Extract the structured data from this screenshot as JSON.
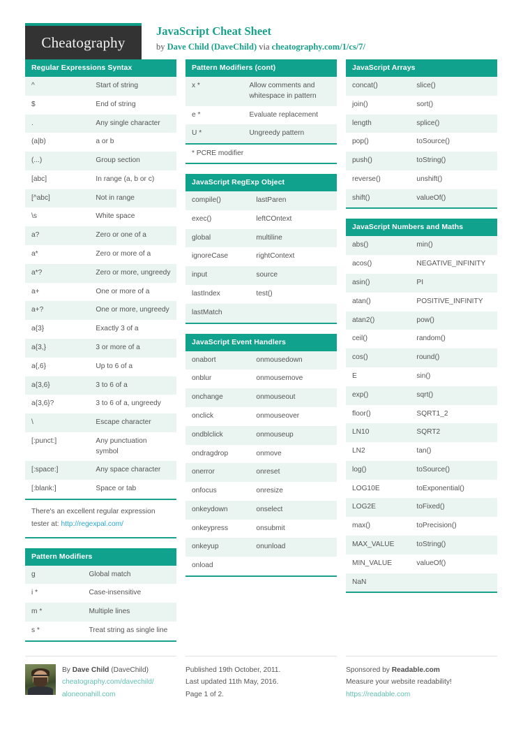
{
  "header": {
    "logo": "Cheatography",
    "title": "JavaScript Cheat Sheet",
    "by_prefix": "by ",
    "author": "Dave Child (DaveChild)",
    "via": " via ",
    "source_url": "cheatography.com/1/cs/7/"
  },
  "accent_color": "#10a28c",
  "columns": [
    {
      "blocks": [
        {
          "type": "table",
          "title": "Regular Expressions Syntax",
          "rows": [
            [
              "^",
              "Start of string"
            ],
            [
              "$",
              "End of string"
            ],
            [
              ".",
              "Any single character"
            ],
            [
              "(a|b)",
              "a or b"
            ],
            [
              "(...)",
              "Group section"
            ],
            [
              "[abc]",
              "In range (a, b or c)"
            ],
            [
              "[^abc]",
              "Not in range"
            ],
            [
              "\\s",
              "White space"
            ],
            [
              "a?",
              "Zero or one of a"
            ],
            [
              "a*",
              "Zero or more of a"
            ],
            [
              "a*?",
              "Zero or more, ungreedy"
            ],
            [
              "a+",
              "One or more of a"
            ],
            [
              "a+?",
              "One or more, ungreedy"
            ],
            [
              "a{3}",
              "Exactly 3 of a"
            ],
            [
              "a{3,}",
              "3 or more of a"
            ],
            [
              "a{,6}",
              "Up to 6 of a"
            ],
            [
              "a{3,6}",
              "3 to 6 of a"
            ],
            [
              "a{3,6}?",
              "3 to 6 of a, ungreedy"
            ],
            [
              "\\",
              "Escape character"
            ],
            [
              "[:punct:]",
              "Any punctuation symbol"
            ],
            [
              "[:space:]",
              "Any space character"
            ],
            [
              "[:blank:]",
              "Space or tab"
            ]
          ],
          "note_text": "There's an excellent regular expression tester at: ",
          "note_link": "http://regexpal.com/"
        },
        {
          "type": "table",
          "title": "Pattern Modifiers",
          "rows": [
            [
              "g",
              "Global match"
            ],
            [
              "i *",
              "Case-insensitive"
            ],
            [
              "m *",
              "Multiple lines"
            ],
            [
              "s *",
              "Treat string as single line"
            ]
          ]
        }
      ]
    },
    {
      "blocks": [
        {
          "type": "table",
          "title": "Pattern Modifiers (cont)",
          "rows": [
            [
              "x *",
              "Allow comments and whitespace in pattern"
            ],
            [
              "e *",
              "Evaluate replacement"
            ],
            [
              "U *",
              "Ungreedy pattern"
            ]
          ],
          "footnote": "* PCRE modifier"
        },
        {
          "type": "table",
          "title": "JavaScript RegExp Object",
          "rows": [
            [
              "compile()",
              "lastParen"
            ],
            [
              "exec()",
              "leftCOntext"
            ],
            [
              "global",
              "multiline"
            ],
            [
              "ignoreCase",
              "rightContext"
            ],
            [
              "input",
              "source"
            ],
            [
              "lastIndex",
              "test()"
            ],
            [
              "lastMatch",
              ""
            ]
          ]
        },
        {
          "type": "table",
          "title": "JavaScript Event Handlers",
          "rows": [
            [
              "onabort",
              "onmousedown"
            ],
            [
              "onblur",
              "onmousemove"
            ],
            [
              "onchange",
              "onmouseout"
            ],
            [
              "onclick",
              "onmouseover"
            ],
            [
              "ondblclick",
              "onmouseup"
            ],
            [
              "ondragdrop",
              "onmove"
            ],
            [
              "onerror",
              "onreset"
            ],
            [
              "onfocus",
              "onresize"
            ],
            [
              "onkeydown",
              "onselect"
            ],
            [
              "onkeypress",
              "onsubmit"
            ],
            [
              "onkeyup",
              "onunload"
            ],
            [
              "onload",
              ""
            ]
          ]
        }
      ]
    },
    {
      "blocks": [
        {
          "type": "table",
          "title": "JavaScript Arrays",
          "rows": [
            [
              "concat()",
              "slice()"
            ],
            [
              "join()",
              "sort()"
            ],
            [
              "length",
              "splice()"
            ],
            [
              "pop()",
              "toSource()"
            ],
            [
              "push()",
              "toString()"
            ],
            [
              "reverse()",
              "unshift()"
            ],
            [
              "shift()",
              "valueOf()"
            ]
          ]
        },
        {
          "type": "table",
          "title": "JavaScript Numbers and Maths",
          "rows": [
            [
              "abs()",
              "min()"
            ],
            [
              "acos()",
              "NEGATIVE_INFINITY"
            ],
            [
              "asin()",
              "PI"
            ],
            [
              "atan()",
              "POSITIVE_INFINITY"
            ],
            [
              "atan2()",
              "pow()"
            ],
            [
              "ceil()",
              "random()"
            ],
            [
              "cos()",
              "round()"
            ],
            [
              "E",
              "sin()"
            ],
            [
              "exp()",
              "sqrt()"
            ],
            [
              "floor()",
              "SQRT1_2"
            ],
            [
              "LN10",
              "SQRT2"
            ],
            [
              "LN2",
              "tan()"
            ],
            [
              "log()",
              "toSource()"
            ],
            [
              "LOG10E",
              "toExponential()"
            ],
            [
              "LOG2E",
              "toFixed()"
            ],
            [
              "max()",
              "toPrecision()"
            ],
            [
              "MAX_VALUE",
              "toString()"
            ],
            [
              "MIN_VALUE",
              "valueOf()"
            ],
            [
              "NaN",
              ""
            ]
          ]
        }
      ]
    }
  ],
  "footer": {
    "author": {
      "by_prefix": "By ",
      "name": "Dave Child",
      "handle": " (DaveChild)",
      "link1": "cheatography.com/davechild/",
      "link2": "aloneonahill.com"
    },
    "publish": {
      "published": "Published 19th October, 2011.",
      "updated": "Last updated 11th May, 2016.",
      "page": "Page 1 of 2."
    },
    "sponsor": {
      "prefix": "Sponsored by ",
      "name": "Readable.com",
      "tagline": "Measure your website readability!",
      "link": "https://readable.com"
    }
  }
}
